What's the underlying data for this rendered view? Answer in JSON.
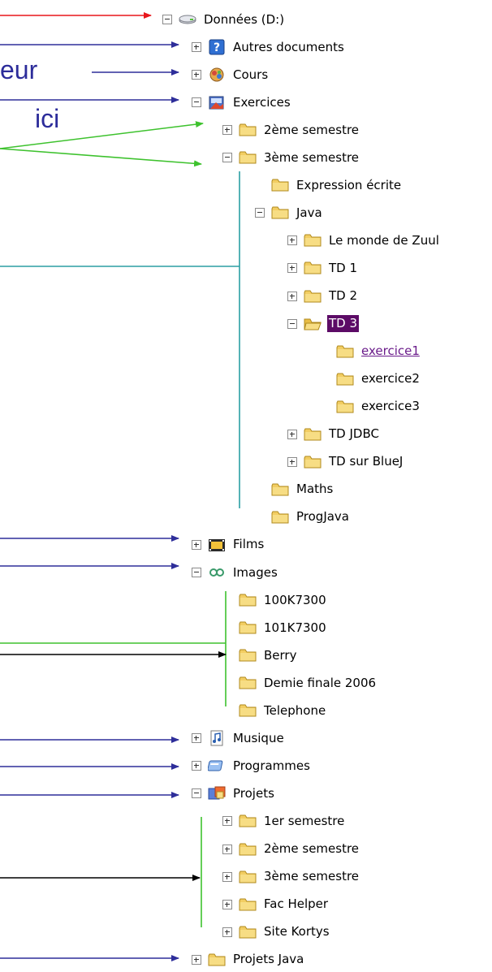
{
  "annotations": {
    "eur": "eur",
    "ici": "ici"
  },
  "colors": {
    "red": "#e8161c",
    "navy": "#2e2e9a",
    "green": "#3ec22e",
    "teal": "#2b9ea3",
    "black": "#000000",
    "folder": "#f2cd62",
    "selection": "#5c0b66"
  },
  "tree": [
    {
      "label": "Données (D:)",
      "toggle": "minus",
      "icon": "drive-icon",
      "level": 0
    },
    {
      "label": "Autres documents",
      "toggle": "plus",
      "icon": "help-icon",
      "level": 1
    },
    {
      "label": "Cours",
      "toggle": "plus",
      "icon": "cours-icon",
      "level": 1
    },
    {
      "label": "Exercices",
      "toggle": "minus",
      "icon": "exercices-icon",
      "level": 1
    },
    {
      "label": "2ème semestre",
      "toggle": "plus",
      "icon": "folder-icon",
      "level": 2
    },
    {
      "label": "3ème semestre",
      "toggle": "minus",
      "icon": "folder-icon",
      "level": 2
    },
    {
      "label": "Expression écrite",
      "toggle": "none",
      "icon": "folder-icon",
      "level": 3
    },
    {
      "label": "Java",
      "toggle": "minus",
      "icon": "folder-icon",
      "level": 3
    },
    {
      "label": "Le monde de Zuul",
      "toggle": "plus",
      "icon": "folder-icon",
      "level": 4
    },
    {
      "label": "TD 1",
      "toggle": "plus",
      "icon": "folder-icon",
      "level": 4
    },
    {
      "label": "TD 2",
      "toggle": "plus",
      "icon": "folder-icon",
      "level": 4
    },
    {
      "label": "TD 3",
      "toggle": "minus",
      "icon": "folder-open-icon",
      "level": 4,
      "selected": true
    },
    {
      "label": "exercice1",
      "toggle": "none",
      "icon": "folder-icon",
      "level": 5,
      "link": true
    },
    {
      "label": "exercice2",
      "toggle": "none",
      "icon": "folder-icon",
      "level": 5
    },
    {
      "label": "exercice3",
      "toggle": "none",
      "icon": "folder-icon",
      "level": 5
    },
    {
      "label": "TD JDBC",
      "toggle": "plus",
      "icon": "folder-icon",
      "level": 4
    },
    {
      "label": "TD sur BlueJ",
      "toggle": "plus",
      "icon": "folder-icon",
      "level": 4
    },
    {
      "label": "Maths",
      "toggle": "none",
      "icon": "folder-icon",
      "level": 3
    },
    {
      "label": "ProgJava",
      "toggle": "none",
      "icon": "folder-icon",
      "level": 3
    },
    {
      "label": "Films",
      "toggle": "plus",
      "icon": "film-icon",
      "level": 1
    },
    {
      "label": "Images",
      "toggle": "minus",
      "icon": "images-icon",
      "level": 1
    },
    {
      "label": "100K7300",
      "toggle": "none",
      "icon": "folder-icon",
      "level": 2
    },
    {
      "label": "101K7300",
      "toggle": "none",
      "icon": "folder-icon",
      "level": 2
    },
    {
      "label": "Berry",
      "toggle": "none",
      "icon": "folder-icon",
      "level": 2
    },
    {
      "label": "Demie finale 2006",
      "toggle": "none",
      "icon": "folder-icon",
      "level": 2
    },
    {
      "label": "Telephone",
      "toggle": "none",
      "icon": "folder-icon",
      "level": 2
    },
    {
      "label": "Musique",
      "toggle": "plus",
      "icon": "music-icon",
      "level": 1
    },
    {
      "label": "Programmes",
      "toggle": "plus",
      "icon": "programs-icon",
      "level": 1
    },
    {
      "label": "Projets",
      "toggle": "minus",
      "icon": "projects-icon",
      "level": 1
    },
    {
      "label": "1er semestre",
      "toggle": "plus",
      "icon": "folder-icon",
      "level": 2
    },
    {
      "label": "2ème semestre",
      "toggle": "plus",
      "icon": "folder-icon",
      "level": 2
    },
    {
      "label": "3ème semestre",
      "toggle": "plus",
      "icon": "folder-icon",
      "level": 2
    },
    {
      "label": "Fac Helper",
      "toggle": "plus",
      "icon": "folder-icon",
      "level": 2
    },
    {
      "label": "Site Kortys",
      "toggle": "plus",
      "icon": "folder-icon",
      "level": 2
    },
    {
      "label": "Projets Java",
      "toggle": "plus",
      "icon": "folder-icon",
      "level": 1
    }
  ]
}
